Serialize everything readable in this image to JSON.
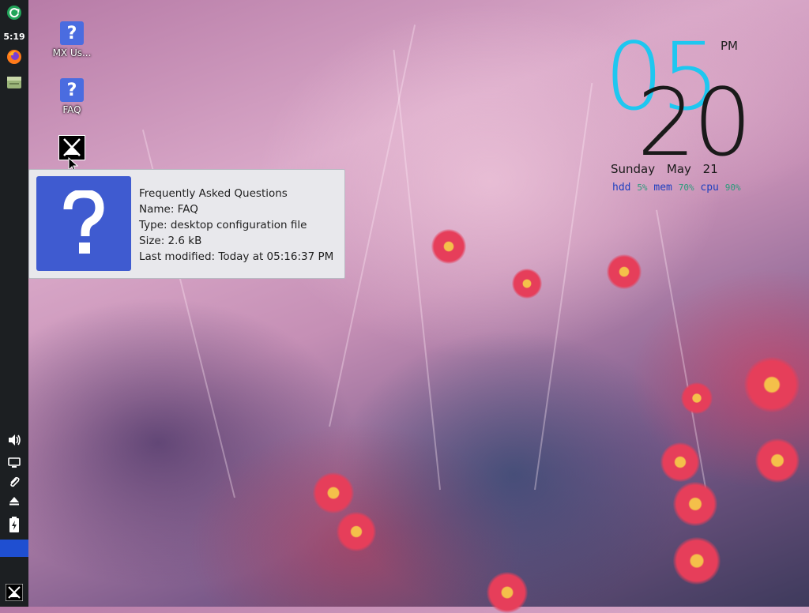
{
  "panel": {
    "clock": "5:19",
    "icons": [
      "update-icon",
      "firefox-icon",
      "file-manager-icon",
      "volume-icon",
      "display-icon",
      "clipboard-icon",
      "eject-icon",
      "battery-icon",
      "mx-logo-icon"
    ]
  },
  "desktop": {
    "icons": [
      {
        "label": "MX Us...",
        "icon": "help-icon"
      },
      {
        "label": "FAQ",
        "icon": "help-icon"
      },
      {
        "label": "",
        "icon": "mx-logo-icon"
      }
    ]
  },
  "tooltip": {
    "title": "Frequently Asked Questions",
    "name": "Name: FAQ",
    "type": "Type: desktop configuration file",
    "size": "Size: 2.6 kB",
    "modified": "Last modified: Today at 05:16:37 PM"
  },
  "conky": {
    "hours": "05",
    "minutes": "20",
    "ampm": "PM",
    "date": "Sunday May 21",
    "stats": [
      {
        "label": "hdd",
        "value": "5%"
      },
      {
        "label": "mem",
        "value": "70%"
      },
      {
        "label": "cpu",
        "value": "90%"
      }
    ]
  },
  "colors": {
    "panel_bg": "#1c1f22",
    "accent_blue": "#1f4fd1",
    "clock_cyan": "#1ec7f0",
    "stats_label": "#1d3fbf",
    "stats_value": "#2a9b7a"
  }
}
